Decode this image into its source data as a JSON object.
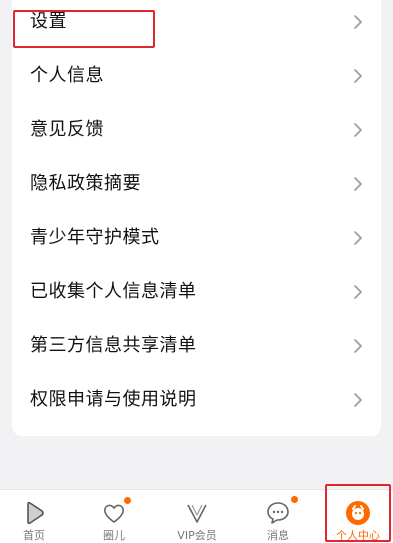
{
  "menu": {
    "items": [
      {
        "label": "设置"
      },
      {
        "label": "个人信息"
      },
      {
        "label": "意见反馈"
      },
      {
        "label": "隐私政策摘要"
      },
      {
        "label": "青少年守护模式"
      },
      {
        "label": "已收集个人信息清单"
      },
      {
        "label": "第三方信息共享清单"
      },
      {
        "label": "权限申请与使用说明"
      }
    ]
  },
  "tabbar": {
    "tabs": [
      {
        "label": "首页",
        "icon": "home-play-icon",
        "badge": false
      },
      {
        "label": "圈儿",
        "icon": "circle-heart-icon",
        "badge": true
      },
      {
        "label": "VIP会员",
        "icon": "vip-v-icon",
        "badge": false
      },
      {
        "label": "消息",
        "icon": "message-bubble-icon",
        "badge": true
      },
      {
        "label": "个人中心",
        "icon": "profile-face-icon",
        "badge": false,
        "active": true
      }
    ]
  },
  "colors": {
    "accent": "#ff6a00",
    "highlight_box": "#e0262f",
    "background": "#f2f2f4"
  }
}
